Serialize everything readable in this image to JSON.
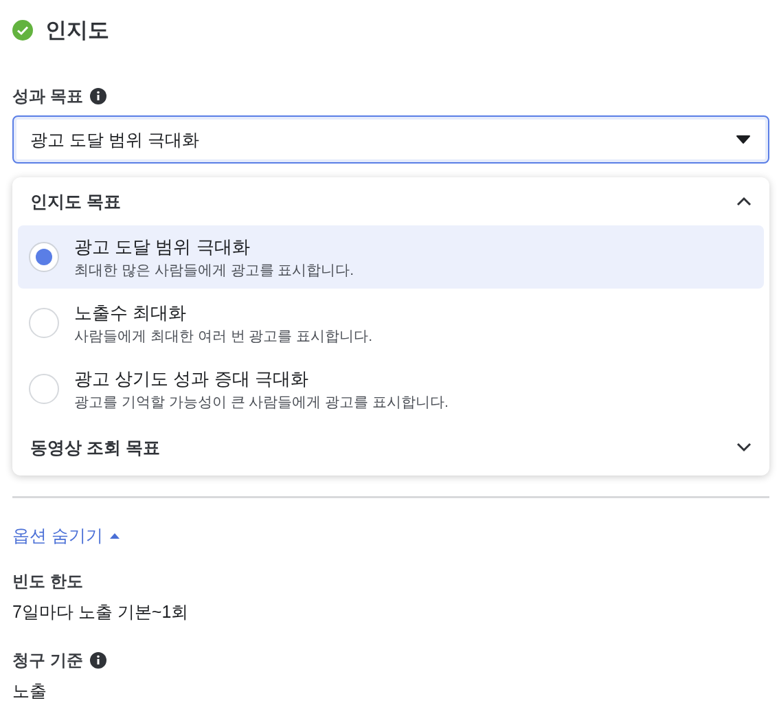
{
  "header": {
    "title": "인지도",
    "complete": true
  },
  "performance_goal": {
    "label": "성과 목표",
    "info": true,
    "value": "광고 도달 범위 극대화"
  },
  "dropdown": {
    "groups": [
      {
        "title": "인지도 목표",
        "expanded": true,
        "options": [
          {
            "title": "광고 도달 범위 극대화",
            "description": "최대한 많은 사람들에게 광고를 표시합니다.",
            "selected": true
          },
          {
            "title": "노출수 최대화",
            "description": "사람들에게 최대한 여러 번 광고를 표시합니다.",
            "selected": false
          },
          {
            "title": "광고 상기도 성과 증대 극대화",
            "description": "광고를 기억할 가능성이 큰 사람들에게 광고를 표시합니다.",
            "selected": false
          }
        ]
      },
      {
        "title": "동영상 조회 목표",
        "expanded": false
      }
    ]
  },
  "toggle_link": {
    "label": "옵션 숨기기",
    "expanded": true
  },
  "settings": [
    {
      "label": "빈도 한도",
      "info": false,
      "value": "7일마다 노출 기본~1회"
    },
    {
      "label": "청구 기준",
      "info": true,
      "value": "노출"
    }
  ]
}
